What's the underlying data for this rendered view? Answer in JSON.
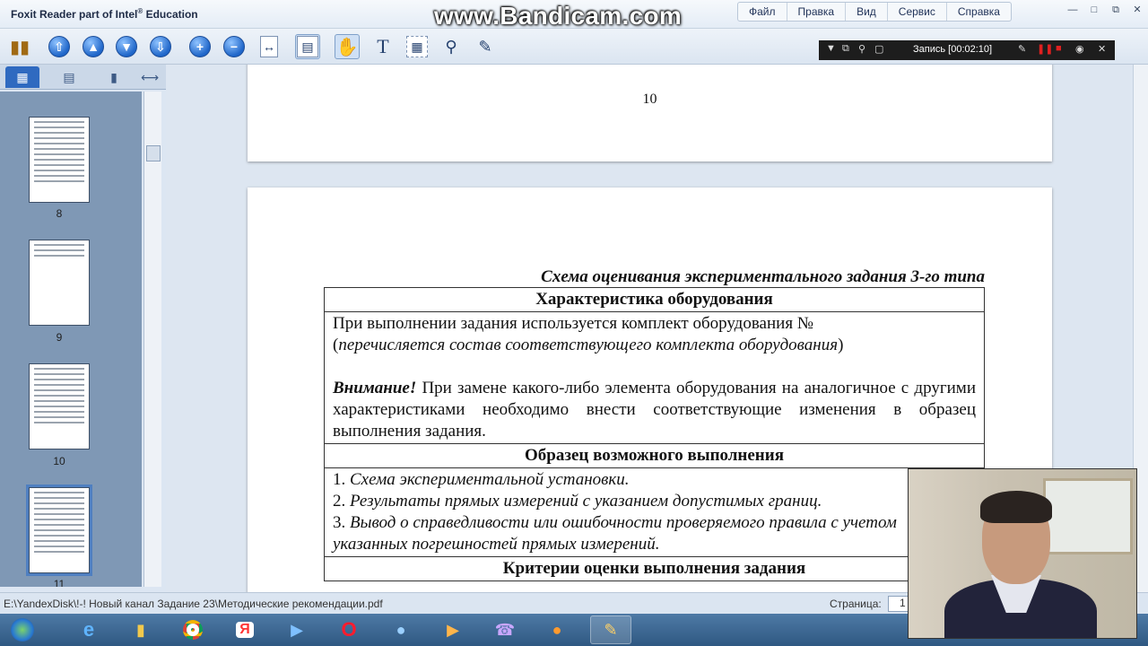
{
  "window": {
    "title_prefix": "Foxit Reader part of Intel",
    "title_sup": "®",
    "title_suffix": " Education",
    "watermark": "www.Bandicam.com"
  },
  "menu": [
    "Файл",
    "Правка",
    "Вид",
    "Сервис",
    "Справка"
  ],
  "recording": {
    "label": "Запись [00:02:10]"
  },
  "sidebar": {
    "thumbnails": [
      {
        "label": "8"
      },
      {
        "label": "9"
      },
      {
        "label": "10"
      },
      {
        "label": "11"
      }
    ]
  },
  "document": {
    "prev_page_number": "10",
    "scheme_title": "Схема оценивания экспериментального задания 3-го типа",
    "equipment_header": "Характеристика оборудования",
    "equipment_line1": "При выполнении задания используется комплект оборудования №",
    "equipment_line2_open": "(",
    "equipment_line2_italic": "перечисляется состав соответствующего комплекта оборудования",
    "equipment_line2_close": ")",
    "warning_label": "Внимание!",
    "warning_text": " При замене какого-либо элемента оборудования на аналогичное с другими характеристиками необходимо внести соответствующие изменения в образец выполнения задания.",
    "sample_header": "Образец возможного выполнения",
    "sample_items": [
      {
        "num": "1. ",
        "text": "Схема экспериментальной установки."
      },
      {
        "num": "2. ",
        "text": "Результаты прямых измерений с указанием допустимых границ."
      },
      {
        "num": "3. ",
        "text": "Вывод о справедливости или ошибочности проверяемого правила с учетом указанных погрешностей прямых измерений."
      }
    ],
    "criteria_header": "Критерии оценки выполнения задания"
  },
  "status": {
    "file_path": "E:\\YandexDisk\\!-! Новый канал Задание 23\\Методические рекомендации.pdf",
    "page_label": "Страница:",
    "page_value": "1"
  }
}
